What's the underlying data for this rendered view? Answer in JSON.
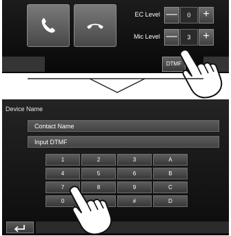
{
  "call_panel": {
    "call_icon": "phone-handset-icon",
    "hangup_icon": "phone-hangup-icon",
    "ec_level": {
      "label": "EC Level",
      "minus": "—",
      "value": "0",
      "plus": "+"
    },
    "mic_level": {
      "label": "Mic Level",
      "minus": "—",
      "value": "3",
      "plus": "+"
    },
    "dtmf_button": "DTMF"
  },
  "dtmf_screen": {
    "device_name": "Device Name",
    "contact_name": "Contact Name",
    "input_dtmf": "Input DTMF",
    "keys": [
      "1",
      "2",
      "3",
      "A",
      "4",
      "5",
      "6",
      "B",
      "7",
      "8",
      "9",
      "C",
      "0",
      "*",
      "#",
      "D"
    ],
    "back_icon": "return-arrow-icon"
  },
  "colors": {
    "panel_bg": "#0c0c0c",
    "button_bg": "#4a4a4a",
    "text": "#ffffff"
  }
}
